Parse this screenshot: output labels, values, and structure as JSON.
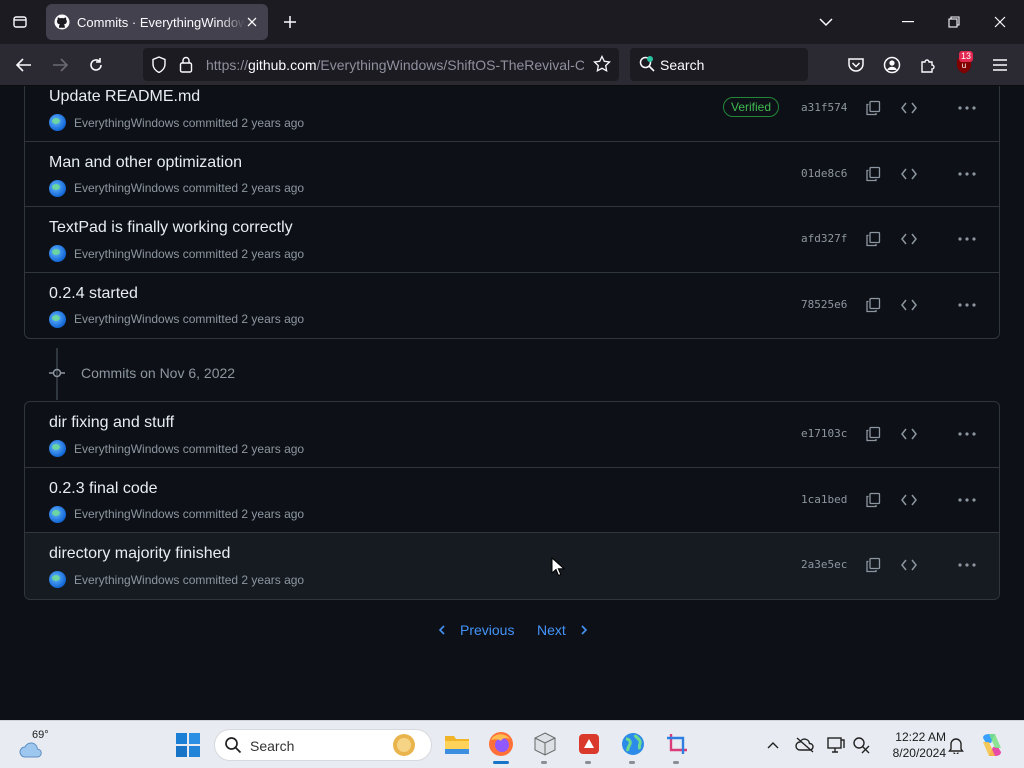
{
  "browser": {
    "tab_title": "Commits · EverythingWindows/ShiftOS-TheRevival",
    "url_prefix": "https://",
    "url_host": "github.com",
    "url_path": "/EverythingWindows/ShiftOS-TheRevival-C",
    "search_placeholder": "Search",
    "extension_badge": "13"
  },
  "commit_groups": [
    {
      "commits": [
        {
          "message": "Update README.md",
          "author": "EverythingWindows",
          "time": " committed 2 years ago",
          "sha": "a31f574",
          "verified": "Verified"
        },
        {
          "message": "Man and other optimization",
          "author": "EverythingWindows",
          "time": " committed 2 years ago",
          "sha": "01de8c6"
        },
        {
          "message": "TextPad is finally working correctly",
          "author": "EverythingWindows",
          "time": " committed 2 years ago",
          "sha": "afd327f"
        },
        {
          "message": "0.2.4 started",
          "author": "EverythingWindows",
          "time": " committed 2 years ago",
          "sha": "78525e6"
        }
      ]
    },
    {
      "date_label": "Commits on Nov 6, 2022",
      "commits": [
        {
          "message": "dir fixing and stuff",
          "author": "EverythingWindows",
          "time": " committed 2 years ago",
          "sha": "e17103c"
        },
        {
          "message": "0.2.3 final code",
          "author": "EverythingWindows",
          "time": " committed 2 years ago",
          "sha": "1ca1bed"
        },
        {
          "message": "directory majority finished",
          "author": "EverythingWindows",
          "time": " committed 2 years ago",
          "sha": "2a3e5ec"
        }
      ]
    }
  ],
  "pagination": {
    "previous": "Previous",
    "next": "Next"
  },
  "taskbar": {
    "weather_temp": "69°",
    "search_placeholder": "Search",
    "time": "12:22 AM",
    "date": "8/20/2024"
  }
}
